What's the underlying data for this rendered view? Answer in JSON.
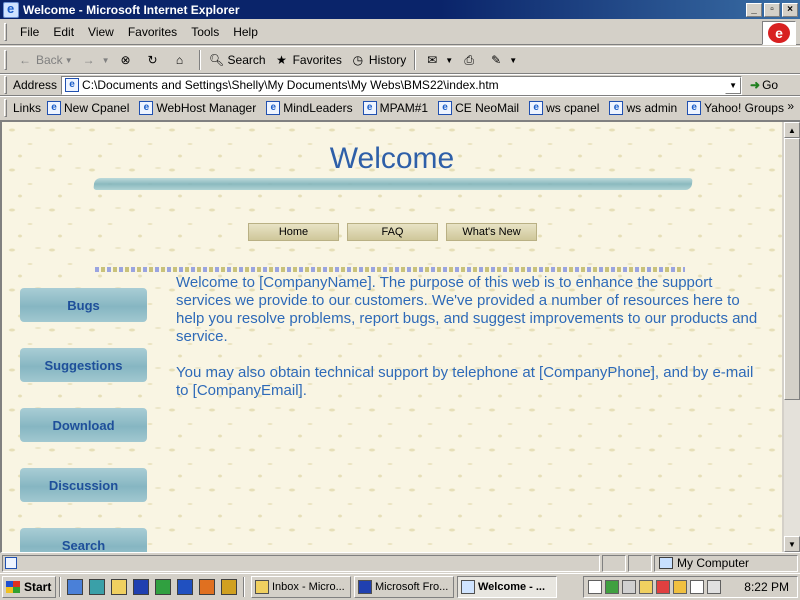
{
  "window": {
    "title": "Welcome - Microsoft Internet Explorer"
  },
  "menu": [
    "File",
    "Edit",
    "View",
    "Favorites",
    "Tools",
    "Help"
  ],
  "toolbar": {
    "back": "Back",
    "search": "Search",
    "favorites": "Favorites",
    "history": "History"
  },
  "address": {
    "label": "Address",
    "url": "C:\\Documents and Settings\\Shelly\\My Documents\\My Webs\\BMS22\\index.htm",
    "go": "Go"
  },
  "links": {
    "label": "Links",
    "items": [
      "New Cpanel",
      "WebHost Manager",
      "MindLeaders",
      "MPAM#1",
      "CE NeoMail",
      "ws cpanel",
      "ws admin",
      "Yahoo! Groups"
    ],
    "more": "»"
  },
  "page": {
    "heading": "Welcome",
    "nav": [
      "Home",
      "FAQ",
      "What's New"
    ],
    "sidebar": [
      "Bugs",
      "Suggestions",
      "Download",
      "Discussion",
      "Search"
    ],
    "paragraph1": "Welcome to [CompanyName]. The purpose of this web is to enhance the support services we provide to our customers. We've provided a number of resources here to help you resolve problems, report bugs, and suggest improvements to our products and service.",
    "paragraph2": "You may also obtain technical support by telephone at [CompanyPhone], and by e-mail to [CompanyEmail]."
  },
  "status": {
    "zone": "My Computer"
  },
  "taskbar": {
    "start": "Start",
    "tasks": [
      "Inbox - Micro...",
      "Microsoft Fro...",
      "Welcome - ..."
    ],
    "clock": "8:22 PM"
  }
}
